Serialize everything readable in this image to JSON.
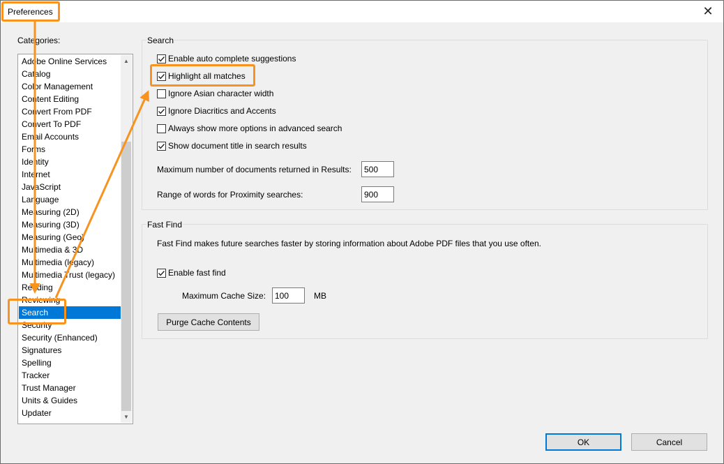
{
  "window": {
    "title": "Preferences"
  },
  "categories": {
    "label": "Categories:",
    "items": [
      "Adobe Online Services",
      "Catalog",
      "Color Management",
      "Content Editing",
      "Convert From PDF",
      "Convert To PDF",
      "Email Accounts",
      "Forms",
      "Identity",
      "Internet",
      "JavaScript",
      "Language",
      "Measuring (2D)",
      "Measuring (3D)",
      "Measuring (Geo)",
      "Multimedia & 3D",
      "Multimedia (legacy)",
      "Multimedia Trust (legacy)",
      "Reading",
      "Reviewing",
      "Search",
      "Security",
      "Security (Enhanced)",
      "Signatures",
      "Spelling",
      "Tracker",
      "Trust Manager",
      "Units & Guides",
      "Updater"
    ],
    "selected": "Search"
  },
  "search": {
    "title": "Search",
    "options": [
      {
        "label": "Enable auto complete suggestions",
        "checked": true
      },
      {
        "label": "Highlight all matches",
        "checked": true
      },
      {
        "label": "Ignore Asian character width",
        "checked": false
      },
      {
        "label": "Ignore Diacritics and Accents",
        "checked": true
      },
      {
        "label": "Always show more options in advanced search",
        "checked": false
      },
      {
        "label": "Show document title in search results",
        "checked": true
      }
    ],
    "max_docs_label": "Maximum number of documents returned in Results:",
    "max_docs_value": "500",
    "proximity_label": "Range of words for Proximity searches:",
    "proximity_value": "900"
  },
  "fast_find": {
    "title": "Fast Find",
    "description": "Fast Find makes future searches faster by storing information about Adobe PDF files that you use often.",
    "enable_label": "Enable fast find",
    "enable_checked": true,
    "cache_label": "Maximum Cache Size:",
    "cache_value": "100",
    "cache_unit": "MB",
    "purge_label": "Purge Cache Contents"
  },
  "buttons": {
    "ok": "OK",
    "cancel": "Cancel"
  },
  "icons": {
    "close": "close-icon",
    "scroll_up": "chevron-up-icon",
    "scroll_down": "chevron-down-icon",
    "check": "checkmark-icon"
  },
  "colors": {
    "selection": "#0078d7",
    "callout": "#f7931e"
  }
}
